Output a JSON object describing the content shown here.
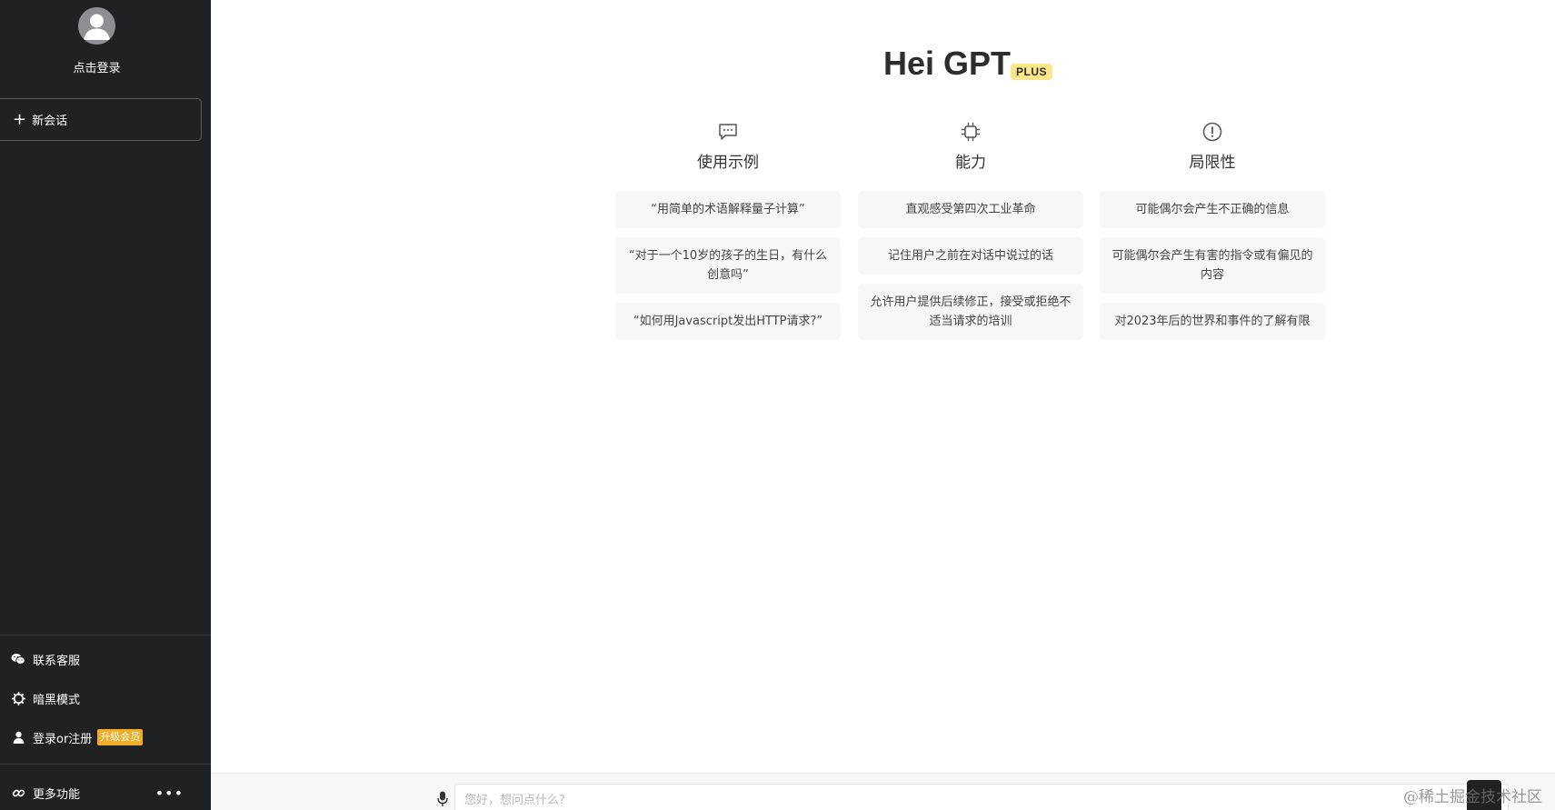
{
  "sidebar": {
    "login_text": "点击登录",
    "new_chat_label": "新会话",
    "new_chat_icon": "+",
    "bottom_items": [
      {
        "label": "联系客服",
        "icon": "wechat-icon"
      },
      {
        "label": "暗黑模式",
        "icon": "gear-icon"
      },
      {
        "label": "登录or注册",
        "icon": "user-icon",
        "badge": "升级会员"
      }
    ],
    "more": {
      "label": "更多功能",
      "icon": "link-icon",
      "dots": "•••"
    }
  },
  "main": {
    "title": "Hei GPT",
    "badge": "PLUS",
    "columns": [
      {
        "icon": "chat-bubble-icon",
        "title": "使用示例",
        "cards": [
          "“用简单的术语解释量子计算”",
          "“对于一个10岁的孩子的生日，有什么创意吗”",
          "“如何用Javascript发出HTTP请求?”"
        ]
      },
      {
        "icon": "chip-icon",
        "title": "能力",
        "cards": [
          "直观感受第四次工业革命",
          "记住用户之前在对话中说过的话",
          "允许用户提供后续修正，接受或拒绝不适当请求的培训"
        ]
      },
      {
        "icon": "warning-circle-icon",
        "title": "局限性",
        "cards": [
          "可能偶尔会产生不正确的信息",
          "可能偶尔会产生有害的指令或有偏见的内容",
          "对2023年后的世界和事件的了解有限"
        ]
      }
    ]
  },
  "input": {
    "placeholder": "您好，想问点什么?",
    "value": ""
  },
  "watermark": "@稀土掘金技术社区",
  "colors": {
    "sidebar_bg": "#202123",
    "card_bg": "#f7f7f8",
    "plus_badge_bg": "#fde68a",
    "vip_badge_bg": "#f0ad28"
  }
}
